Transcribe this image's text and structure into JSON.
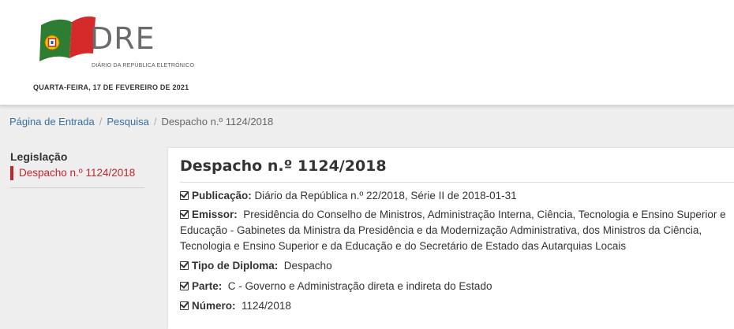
{
  "header": {
    "logo_text": "DRE",
    "logo_subtitle": "DIÁRIO DA REPÚBLICA ELETRÓNICO",
    "date": "QUARTA-FEIRA, 17 DE FEVEREIRO DE 2021"
  },
  "breadcrumb": {
    "items": [
      "Página de Entrada",
      "Pesquisa"
    ],
    "current": "Despacho n.º 1124/2018",
    "separator": "/"
  },
  "sidebar": {
    "title": "Legislação",
    "active_item": "Despacho n.º 1124/2018"
  },
  "main": {
    "title": "Despacho n.º 1124/2018",
    "fields": [
      {
        "label": "Publicação:",
        "value": "Diário da República n.º 22/2018, Série II de 2018-01-31"
      },
      {
        "label": "Emissor:",
        "value": "Presidência do Conselho de Ministros, Administração Interna, Ciência, Tecnologia e Ensino Superior e Educação - Gabinetes da Ministra da Presidência e da Modernização Administrativa, dos Ministros da Ciência, Tecnologia e Ensino Superior e da Educação e do Secretário de Estado das Autarquias Locais"
      },
      {
        "label": "Tipo de Diploma:",
        "value": "Despacho"
      },
      {
        "label": "Parte:",
        "value": "C - Governo e Administração direta e indireta do Estado"
      },
      {
        "label": "Número:",
        "value": "1124/2018"
      }
    ]
  },
  "colors": {
    "accent_red": "#c0272d",
    "link_blue": "#3a6f9c",
    "flag_green": "#2e7d32",
    "flag_red": "#d42a2a"
  }
}
